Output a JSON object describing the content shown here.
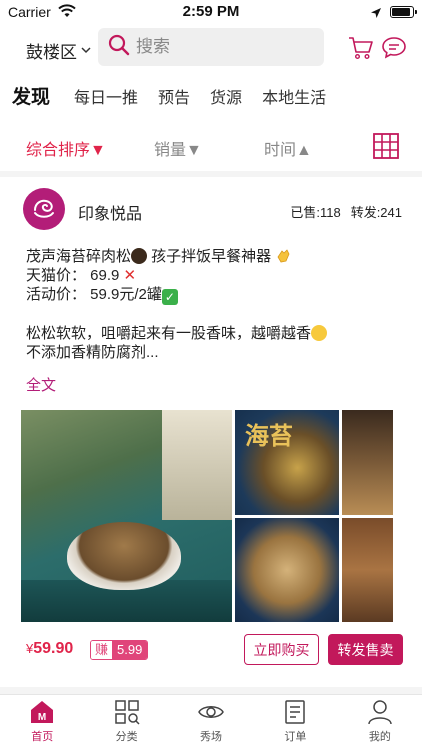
{
  "status_bar": {
    "carrier": "Carrier",
    "time": "2:59 PM",
    "battery_level": 0.9
  },
  "header": {
    "city": "鼓楼区",
    "search_placeholder": "搜索",
    "icons": [
      "cart-icon",
      "message-icon"
    ]
  },
  "category_tabs": [
    {
      "label": "发现",
      "active": true
    },
    {
      "label": "每日一推",
      "active": false
    },
    {
      "label": "预告",
      "active": false
    },
    {
      "label": "货源",
      "active": false
    },
    {
      "label": "本地生活",
      "active": false
    }
  ],
  "sort_bar": {
    "items": [
      {
        "label": "综合排序▼",
        "active": true
      },
      {
        "label": "销量▼",
        "active": false
      },
      {
        "label": "时间▲",
        "active": false
      }
    ],
    "grid_icon": "grid-view-icon"
  },
  "post": {
    "shop_name": "印象悦品",
    "sold": "已售:118",
    "shared": "转发:241",
    "lines": {
      "title": "茂声海苔碎肉松",
      "title_tail": " 孩子拌饭早餐神器",
      "tmall_price": "天猫价：  69.9 ",
      "promo_price": "活动价：  59.9元/2罐",
      "desc1": "松松软软，咀嚼起来有一股香味，越嚼越香",
      "desc2": "不添加香精防腐剂..."
    },
    "fulltext_link": "全文",
    "photo_text": "海苔",
    "price": "59.90",
    "price_currency": "¥",
    "earn_tag": "赚",
    "earn_amount": "5.99",
    "buy_button": "立即购买",
    "resell_button": "转发售卖"
  },
  "tab_bar": [
    {
      "label": "首页",
      "icon": "home-icon",
      "active": true
    },
    {
      "label": "分类",
      "icon": "category-icon",
      "active": false
    },
    {
      "label": "秀场",
      "icon": "eye-icon",
      "active": false
    },
    {
      "label": "订单",
      "icon": "order-icon",
      "active": false
    },
    {
      "label": "我的",
      "icon": "profile-icon",
      "active": false
    }
  ],
  "colors": {
    "accent": "#c2185b",
    "sort_active": "#e0244a",
    "avatar_bg": "#b31d78"
  }
}
